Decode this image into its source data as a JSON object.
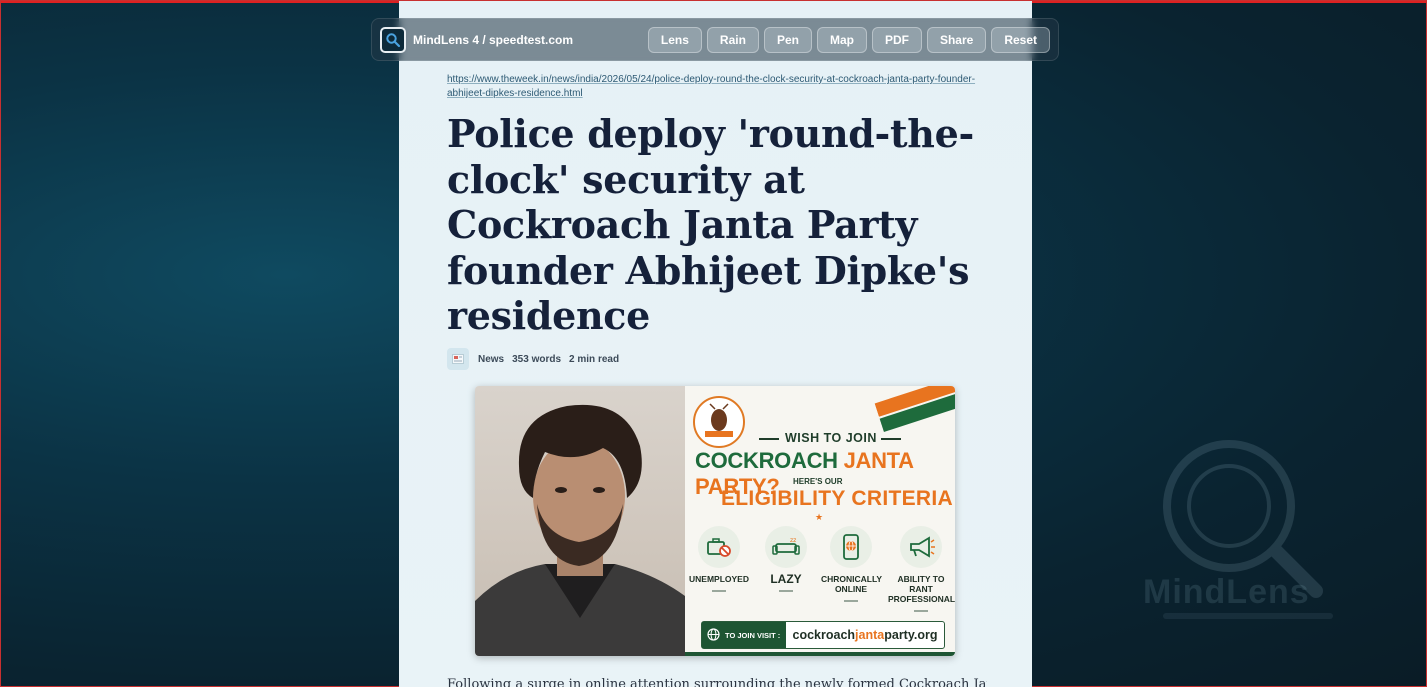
{
  "toolbar": {
    "title": "MindLens 4 / speedtest.com",
    "logo_icon": "search-magnifier-icon",
    "buttons": [
      "Lens",
      "Rain",
      "Pen",
      "Map",
      "PDF",
      "Share",
      "Reset"
    ]
  },
  "article": {
    "url": "https://www.theweek.in/news/india/2026/05/24/police-deploy-round-the-clock-security-at-cockroach-janta-party-founder-abhijeet-dipkes-residence.html",
    "headline": "Police deploy 'round-the-clock' security at Cockroach Janta Party founder Abhijeet Dipke's residence",
    "meta": {
      "category": "News",
      "words": "353 words",
      "read_time": "2 min read"
    },
    "body_start": "Following a surge in online attention surrounding the newly formed Cockroach Janta Party"
  },
  "poster": {
    "emblem_text": "COCKROACH JANTA PARTY",
    "wish_to_join": "WISH TO JOIN",
    "party_word1": "COCKROACH",
    "party_word2": "JANTA PARTY?",
    "heres_our": "HERE'S OUR",
    "criteria_title": "ELIGIBILITY CRITERIA",
    "criteria": [
      {
        "label": "UNEMPLOYED",
        "icon": "briefcase-ban-icon"
      },
      {
        "label": "LAZY",
        "icon": "sofa-icon"
      },
      {
        "label": "CHRONICALLY ONLINE",
        "icon": "phone-globe-icon"
      },
      {
        "label": "ABILITY TO RANT PROFESSIONALLY",
        "icon": "megaphone-icon"
      }
    ],
    "visit_label": "TO JOIN VISIT :",
    "site_part1": "cockroach",
    "site_part2": "janta",
    "site_part3": "party.org"
  },
  "watermark": {
    "text": "MindLens"
  },
  "colors": {
    "party_green": "#1e6b3c",
    "party_orange": "#e8741f",
    "headline": "#15213a"
  }
}
